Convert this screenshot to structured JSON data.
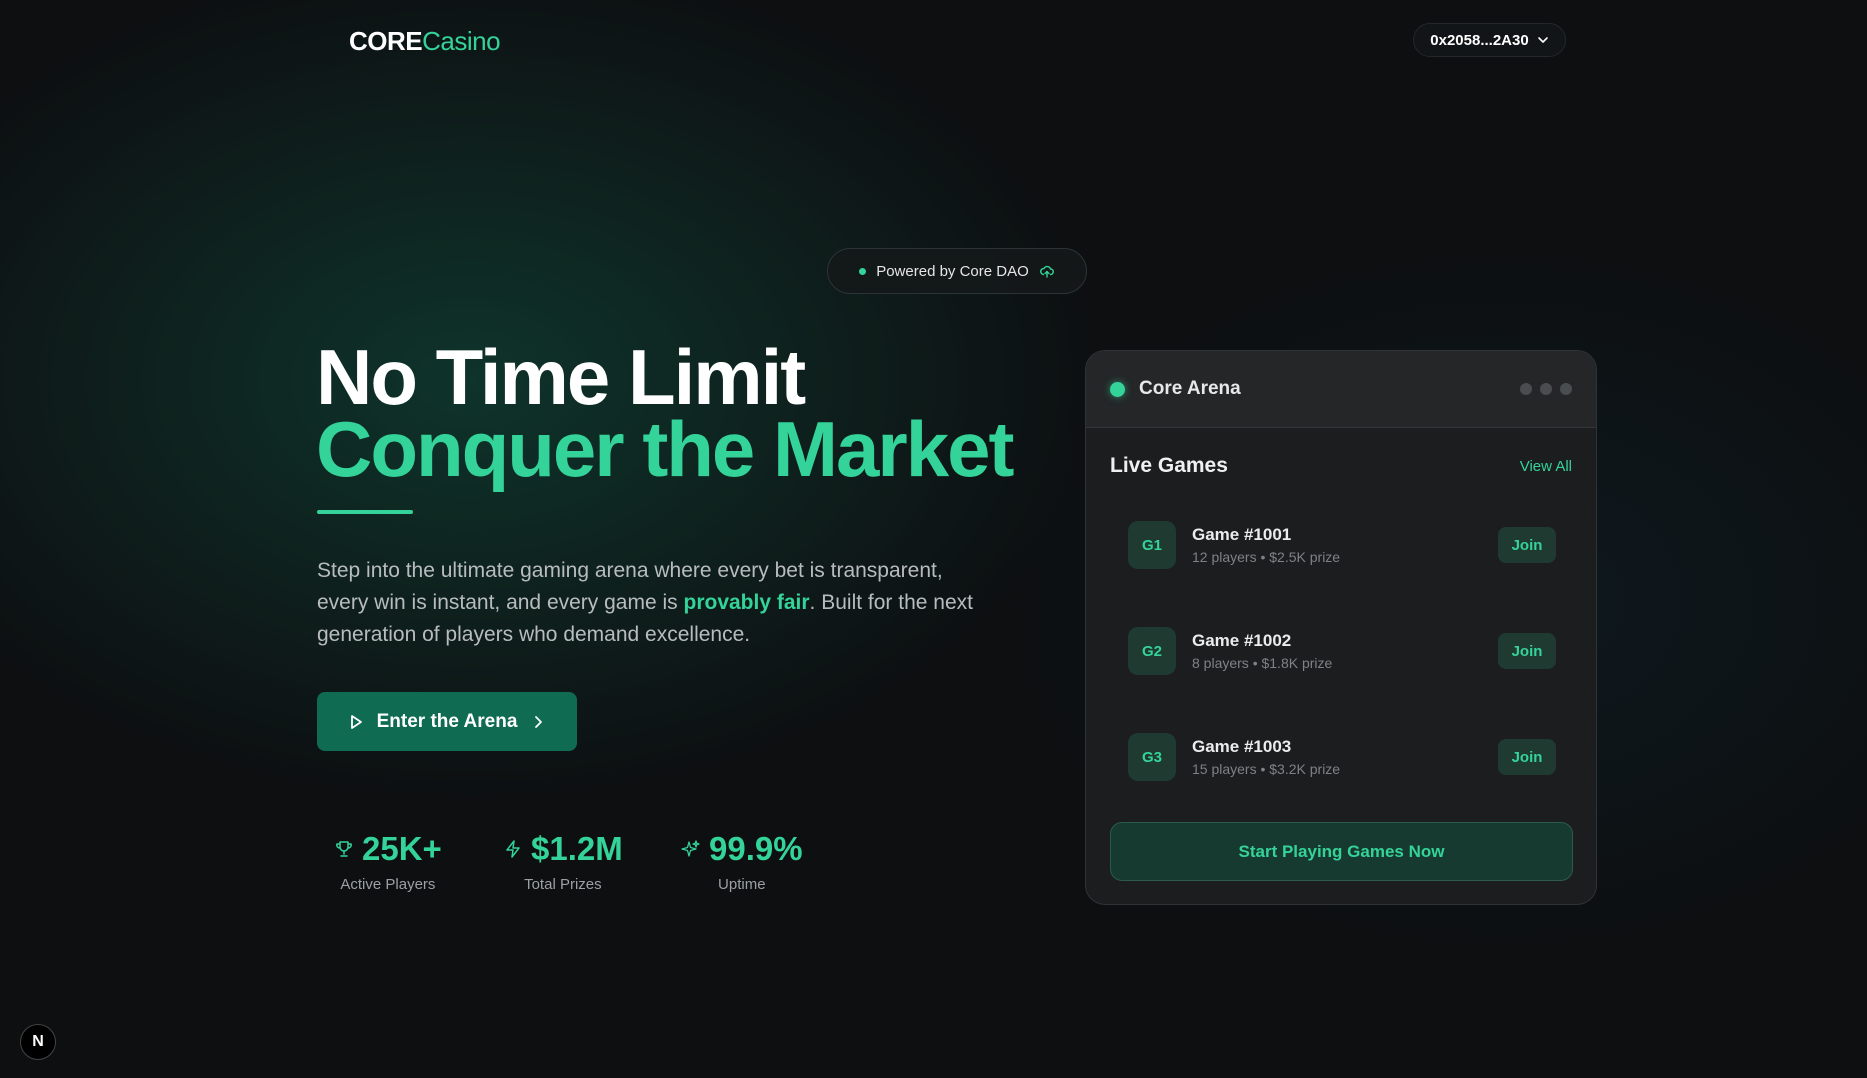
{
  "header": {
    "logo_core": "CORE",
    "logo_casino": "Casino",
    "wallet_address": "0x2058...2A30",
    "wallet_icon": "chevron-down-icon"
  },
  "badge": {
    "text": "Powered by Core DAO",
    "icon": "cloud-upload-icon"
  },
  "hero": {
    "title_line1": "No Time Limit",
    "title_line2": "Conquer the Market",
    "desc_before": "Step into the ultimate gaming arena where every bet is transparent, every win is instant, and every game is ",
    "desc_highlight": "provably fair",
    "desc_after": ". Built for the next generation of players who demand excellence.",
    "cta_label": "Enter the Arena"
  },
  "stats": [
    {
      "icon": "trophy-icon",
      "value": "25K+",
      "label": "Active Players"
    },
    {
      "icon": "lightning-icon",
      "value": "$1.2M",
      "label": "Total Prizes"
    },
    {
      "icon": "sparkle-icon",
      "value": "99.9%",
      "label": "Uptime"
    }
  ],
  "arena": {
    "title": "Core Arena",
    "section_title": "Live Games",
    "view_all": "View All",
    "games": [
      {
        "badge": "G1",
        "name": "Game #1001",
        "meta": "12 players • $2.5K prize",
        "join": "Join"
      },
      {
        "badge": "G2",
        "name": "Game #1002",
        "meta": "8 players • $1.8K prize",
        "join": "Join"
      },
      {
        "badge": "G3",
        "name": "Game #1003",
        "meta": "15 players • $3.2K prize",
        "join": "Join"
      }
    ],
    "cta": "Start Playing Games Now"
  },
  "dev_badge": "N",
  "colors": {
    "accent": "#34d399",
    "button": "#0f6b52",
    "background": "#0d0f11"
  }
}
